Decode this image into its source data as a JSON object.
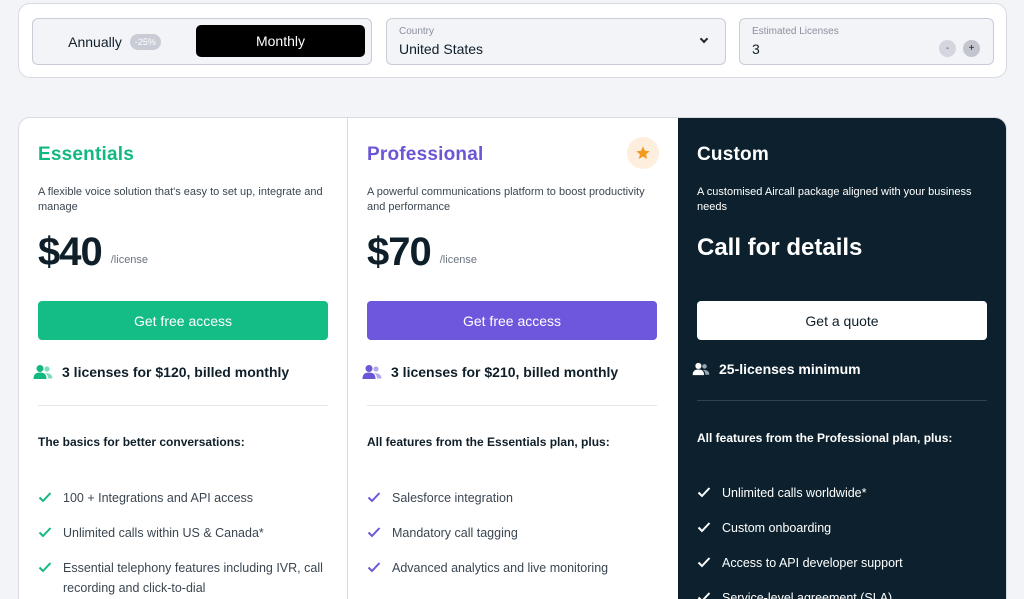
{
  "controls": {
    "annually_label": "Annually",
    "discount_badge": "-25%",
    "monthly_label": "Monthly",
    "country_label": "Country",
    "country_value": "United States",
    "licenses_label": "Estimated Licenses",
    "licenses_value": "3",
    "minus_symbol": "-",
    "plus_symbol": "+"
  },
  "colors": {
    "essentials_accent": "#12b881",
    "professional_accent": "#6a57d8",
    "custom_background": "#0c212d",
    "star": "#f39a1e"
  },
  "plans": {
    "essentials": {
      "title": "Essentials",
      "description": "A flexible voice solution that's easy to set up, integrate and manage",
      "price": "$40",
      "unit": "/license",
      "cta": "Get free access",
      "license_summary": "3 licenses for $120, billed monthly",
      "features_heading": "The basics for better conversations:",
      "features": [
        "100 + Integrations and API access",
        "Unlimited calls within US & Canada*",
        "Essential telephony features including IVR, call recording and click-to-dial"
      ]
    },
    "professional": {
      "title": "Professional",
      "description": "A powerful communications platform to boost productivity and performance",
      "price": "$70",
      "unit": "/license",
      "cta": "Get free access",
      "license_summary": "3 licenses for $210, billed monthly",
      "features_heading": "All features from the Essentials plan, plus:",
      "features": [
        "Salesforce integration",
        "Mandatory call tagging",
        "Advanced analytics and live monitoring"
      ]
    },
    "custom": {
      "title": "Custom",
      "description": "A customised Aircall package aligned with your business needs",
      "price_text": "Call for details",
      "cta": "Get a quote",
      "license_summary": "25-licenses minimum",
      "features_heading": "All features from the Professional plan, plus:",
      "features": [
        "Unlimited calls worldwide*",
        "Custom onboarding",
        "Access to API developer support",
        "Service-level agreement (SLA)"
      ]
    }
  }
}
